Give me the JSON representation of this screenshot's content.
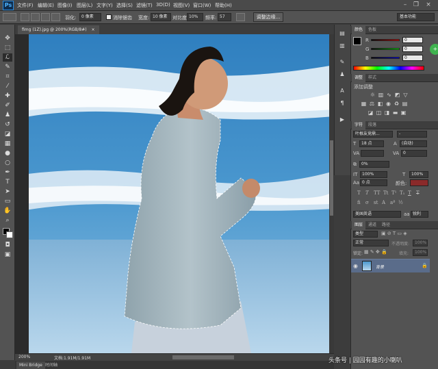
{
  "app": {
    "logo": "Ps"
  },
  "menu": {
    "items": [
      "文件(F)",
      "编辑(E)",
      "图像(I)",
      "图层(L)",
      "文字(Y)",
      "选择(S)",
      "滤镜(T)",
      "3D(D)",
      "视图(V)",
      "窗口(W)",
      "帮助(H)"
    ]
  },
  "window_controls": {
    "minimize": "–",
    "restore": "❐",
    "close": "×"
  },
  "options": {
    "feather_label": "羽化:",
    "feather_value": "0 像素",
    "antialias_label": "消除锯齿",
    "width_label": "宽度:",
    "width_value": "10 像素",
    "contrast_label": "对比度:",
    "contrast_value": "10%",
    "frequency_label": "频率:",
    "frequency_value": "57",
    "refine_edge": "调整边缘...",
    "workspace": "基本功能"
  },
  "document": {
    "tab_title": "fimg (1Z).jpg @ 200%(RGB/8#)",
    "tab_close": "×"
  },
  "status": {
    "zoom": "200%",
    "doc_info": "文档:1.91M/1.91M"
  },
  "bottom_tabs": {
    "mini_bridge": "Mini Bridge",
    "timeline": "时间轴"
  },
  "color_panel": {
    "tabs": [
      "颜色",
      "色板"
    ],
    "r_label": "R",
    "g_label": "G",
    "b_label": "B",
    "r_value": "0",
    "g_value": "0",
    "b_value": "0"
  },
  "adjust_panel": {
    "tabs": [
      "调整",
      "样式"
    ],
    "title": "添加调整"
  },
  "char_panel": {
    "tabs": [
      "字符",
      "段落"
    ],
    "font_family": "叶根友竞鼎...",
    "font_style": "-",
    "size": "18 点",
    "leading": "(自动)",
    "kerning": "",
    "tracking": "0",
    "tsume": "0%",
    "vscale": "100%",
    "hscale": "100%",
    "baseline": "0 点",
    "color_label": "颜色:",
    "language": "美国英语",
    "antialias": "锐利"
  },
  "layers_panel": {
    "tabs": [
      "图层",
      "通道",
      "路径"
    ],
    "kind": "类型",
    "blend": "正常",
    "opacity_label": "不透明度:",
    "opacity": "100%",
    "lock_label": "锁定:",
    "fill_label": "填充:",
    "fill": "100%",
    "layer_name": "背景"
  },
  "watermark": "头条号 | 园园有趣的小喇叭",
  "colors": {
    "accent": "#2b8ce0",
    "fg_swatch": "#000000",
    "bg_swatch": "#ffffff",
    "layer_highlight": "#5a6c8a",
    "text_color_swatch": "#8a2a2a"
  }
}
